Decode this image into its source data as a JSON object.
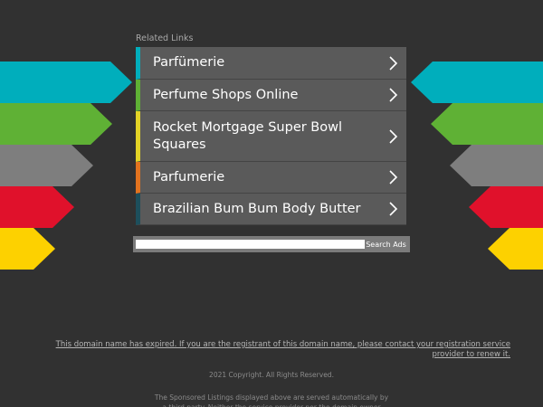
{
  "related_links": {
    "title": "Related Links",
    "items": [
      {
        "label": "Parfümerie",
        "accent": "#00aebc"
      },
      {
        "label": "Perfume Shops Online",
        "accent": "#5fb135"
      },
      {
        "label": "Rocket Mortgage Super Bowl Squares",
        "accent": "#e3d326"
      },
      {
        "label": "Parfumerie",
        "accent": "#e2731f"
      },
      {
        "label": "Brazilian Bum Bum Body Butter",
        "accent": "#1d4f5c"
      }
    ]
  },
  "search": {
    "placeholder": "",
    "button_label": "Search Ads"
  },
  "footer": {
    "expired_notice": "This domain name has expired. If you are the registrant of this domain name, please contact your registration service provider to renew it.",
    "copyright": "2021 Copyright. All Rights Reserved.",
    "sponsored_notice": "The Sponsored Listings displayed above are served automatically by a third party. Neither the service provider nor the domain owner"
  },
  "decor_colors": [
    "#00aebc",
    "#5fb135",
    "#7e7e7e",
    "#e0112b",
    "#fdd100"
  ],
  "icons": {
    "link_chevron": "chevron-right-icon"
  }
}
